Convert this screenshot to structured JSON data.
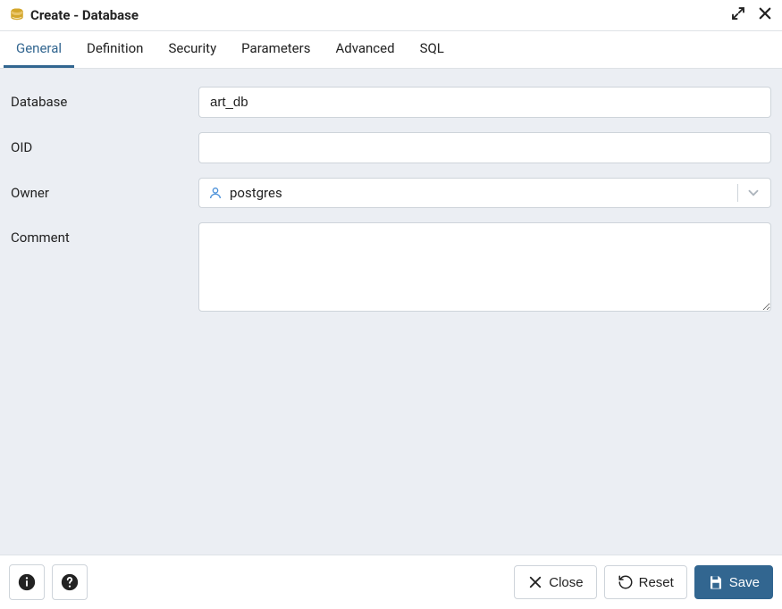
{
  "title": "Create - Database",
  "tabs": [
    {
      "label": "General",
      "active": true
    },
    {
      "label": "Definition",
      "active": false
    },
    {
      "label": "Security",
      "active": false
    },
    {
      "label": "Parameters",
      "active": false
    },
    {
      "label": "Advanced",
      "active": false
    },
    {
      "label": "SQL",
      "active": false
    }
  ],
  "form": {
    "database_label": "Database",
    "database_value": "art_db",
    "oid_label": "OID",
    "oid_value": "",
    "owner_label": "Owner",
    "owner_value": "postgres",
    "comment_label": "Comment",
    "comment_value": ""
  },
  "footer": {
    "close_label": "Close",
    "reset_label": "Reset",
    "save_label": "Save"
  }
}
